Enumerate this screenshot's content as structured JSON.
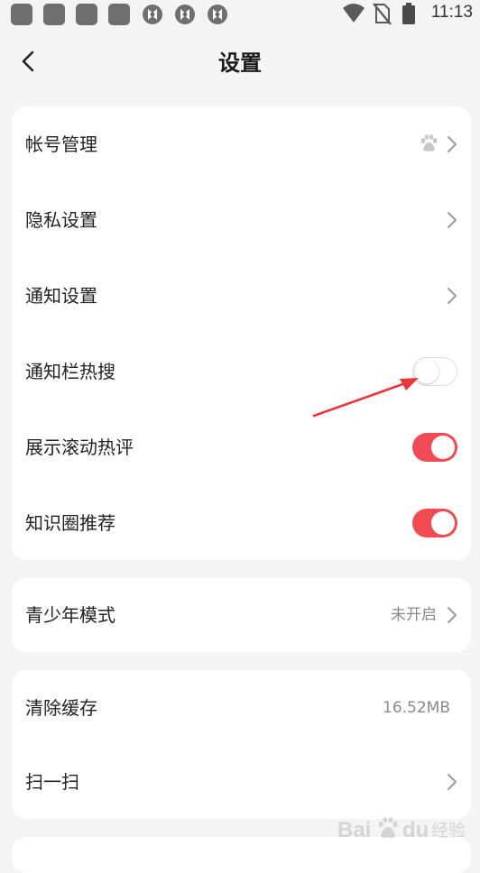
{
  "status_bar": {
    "time": "11:13",
    "icons": [
      "app-icon",
      "app-icon",
      "app-icon",
      "app-icon",
      "sync-icon",
      "sync-icon",
      "sync-icon",
      "wifi-icon",
      "no-sim-icon",
      "battery-icon"
    ]
  },
  "header": {
    "title": "设置",
    "back_icon": "chevron-left-icon"
  },
  "group1": {
    "account": {
      "label": "帐号管理",
      "icon": "baidu-paw-icon"
    },
    "privacy": {
      "label": "隐私设置"
    },
    "notify": {
      "label": "通知设置"
    },
    "notify_hot": {
      "label": "通知栏热搜",
      "enabled": false
    },
    "scroll_comments": {
      "label": "展示滚动热评",
      "enabled": true
    },
    "circle_recommend": {
      "label": "知识圈推荐",
      "enabled": true
    }
  },
  "group2": {
    "youth_mode": {
      "label": "青少年模式",
      "value": "未开启"
    }
  },
  "group3": {
    "clear_cache": {
      "label": "清除缓存",
      "value": "16.52MB"
    },
    "scan": {
      "label": "扫一扫"
    }
  },
  "watermark": {
    "text": "Bai du 经验"
  },
  "colors": {
    "accent": "#f24a53",
    "annotation_arrow": "#e8363c",
    "background": "#f4f4f4"
  }
}
